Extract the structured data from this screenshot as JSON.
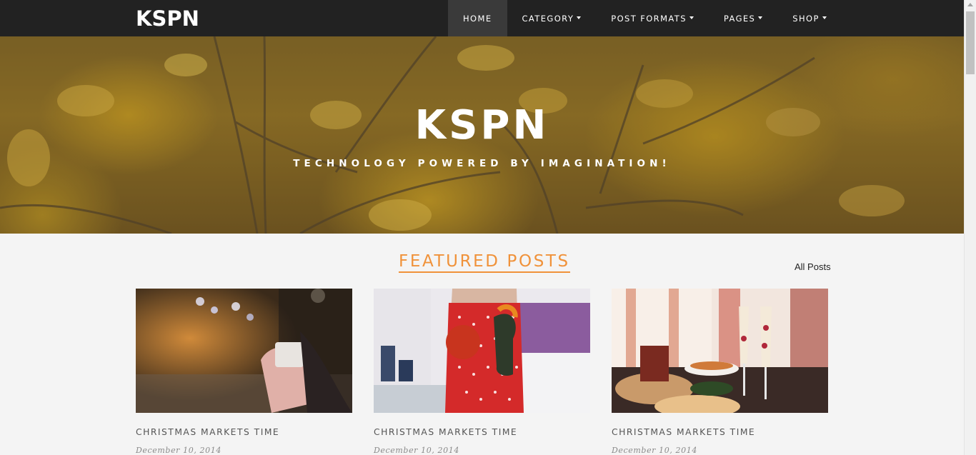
{
  "navbar": {
    "brand": "KSPN",
    "items": [
      {
        "label": "HOME",
        "dropdown": false,
        "active": true
      },
      {
        "label": "CATEGORY",
        "dropdown": true,
        "active": false
      },
      {
        "label": "POST FORMATS",
        "dropdown": true,
        "active": false
      },
      {
        "label": "PAGES",
        "dropdown": true,
        "active": false
      },
      {
        "label": "SHOP",
        "dropdown": true,
        "active": false
      }
    ]
  },
  "hero": {
    "title": "KSPN",
    "subtitle": "TECHNOLOGY POWERED BY IMAGINATION!"
  },
  "featured": {
    "heading": "FEATURED POSTS",
    "all_posts_link": "All Posts",
    "posts": [
      {
        "title": "CHRISTMAS MARKETS TIME",
        "date": "December 10, 2014",
        "image": "christmas-market-hands-cup-photo"
      },
      {
        "title": "CHRISTMAS MARKETS TIME",
        "date": "December 10, 2014",
        "image": "woman-red-apron-vegetables-photo"
      },
      {
        "title": "CHRISTMAS MARKETS TIME",
        "date": "December 10, 2014",
        "image": "party-table-champagne-glasses-photo"
      }
    ]
  },
  "colors": {
    "navbar_bg": "#222222",
    "accent": "#f0923a",
    "page_bg": "#f4f4f4"
  }
}
